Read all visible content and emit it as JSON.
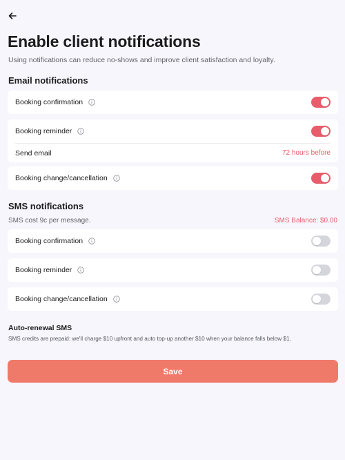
{
  "header": {
    "back_icon": "arrow-left-icon",
    "title": "Enable client notifications",
    "subtitle": "Using notifications can reduce no-shows and improve client satisfaction and loyalty."
  },
  "email": {
    "section_title": "Email notifications",
    "confirmation": {
      "label": "Booking confirmation",
      "enabled": true
    },
    "reminder": {
      "label": "Booking reminder",
      "enabled": true,
      "send_label": "Send email",
      "send_value": "72 hours before"
    },
    "change": {
      "label": "Booking change/cancellation",
      "enabled": true
    }
  },
  "sms": {
    "section_title": "SMS notifications",
    "cost_text": "SMS cost 9c per message.",
    "balance_text": "SMS Balance: $0.00",
    "confirmation": {
      "label": "Booking confirmation",
      "enabled": false
    },
    "reminder": {
      "label": "Booking reminder",
      "enabled": false
    },
    "change": {
      "label": "Booking change/cancellation",
      "enabled": false
    }
  },
  "renewal": {
    "title": "Auto-renewal SMS",
    "description": "SMS credits are prepaid: we'll charge $10 upfront and auto top-up another $10 when your balance falls below $1."
  },
  "actions": {
    "save_label": "Save"
  },
  "colors": {
    "accent": "#e85d6c",
    "save_button": "#f07a6a",
    "background": "#f7f6fc",
    "toggle_off": "#d5d6db"
  },
  "icons": {
    "info": "info-icon"
  }
}
